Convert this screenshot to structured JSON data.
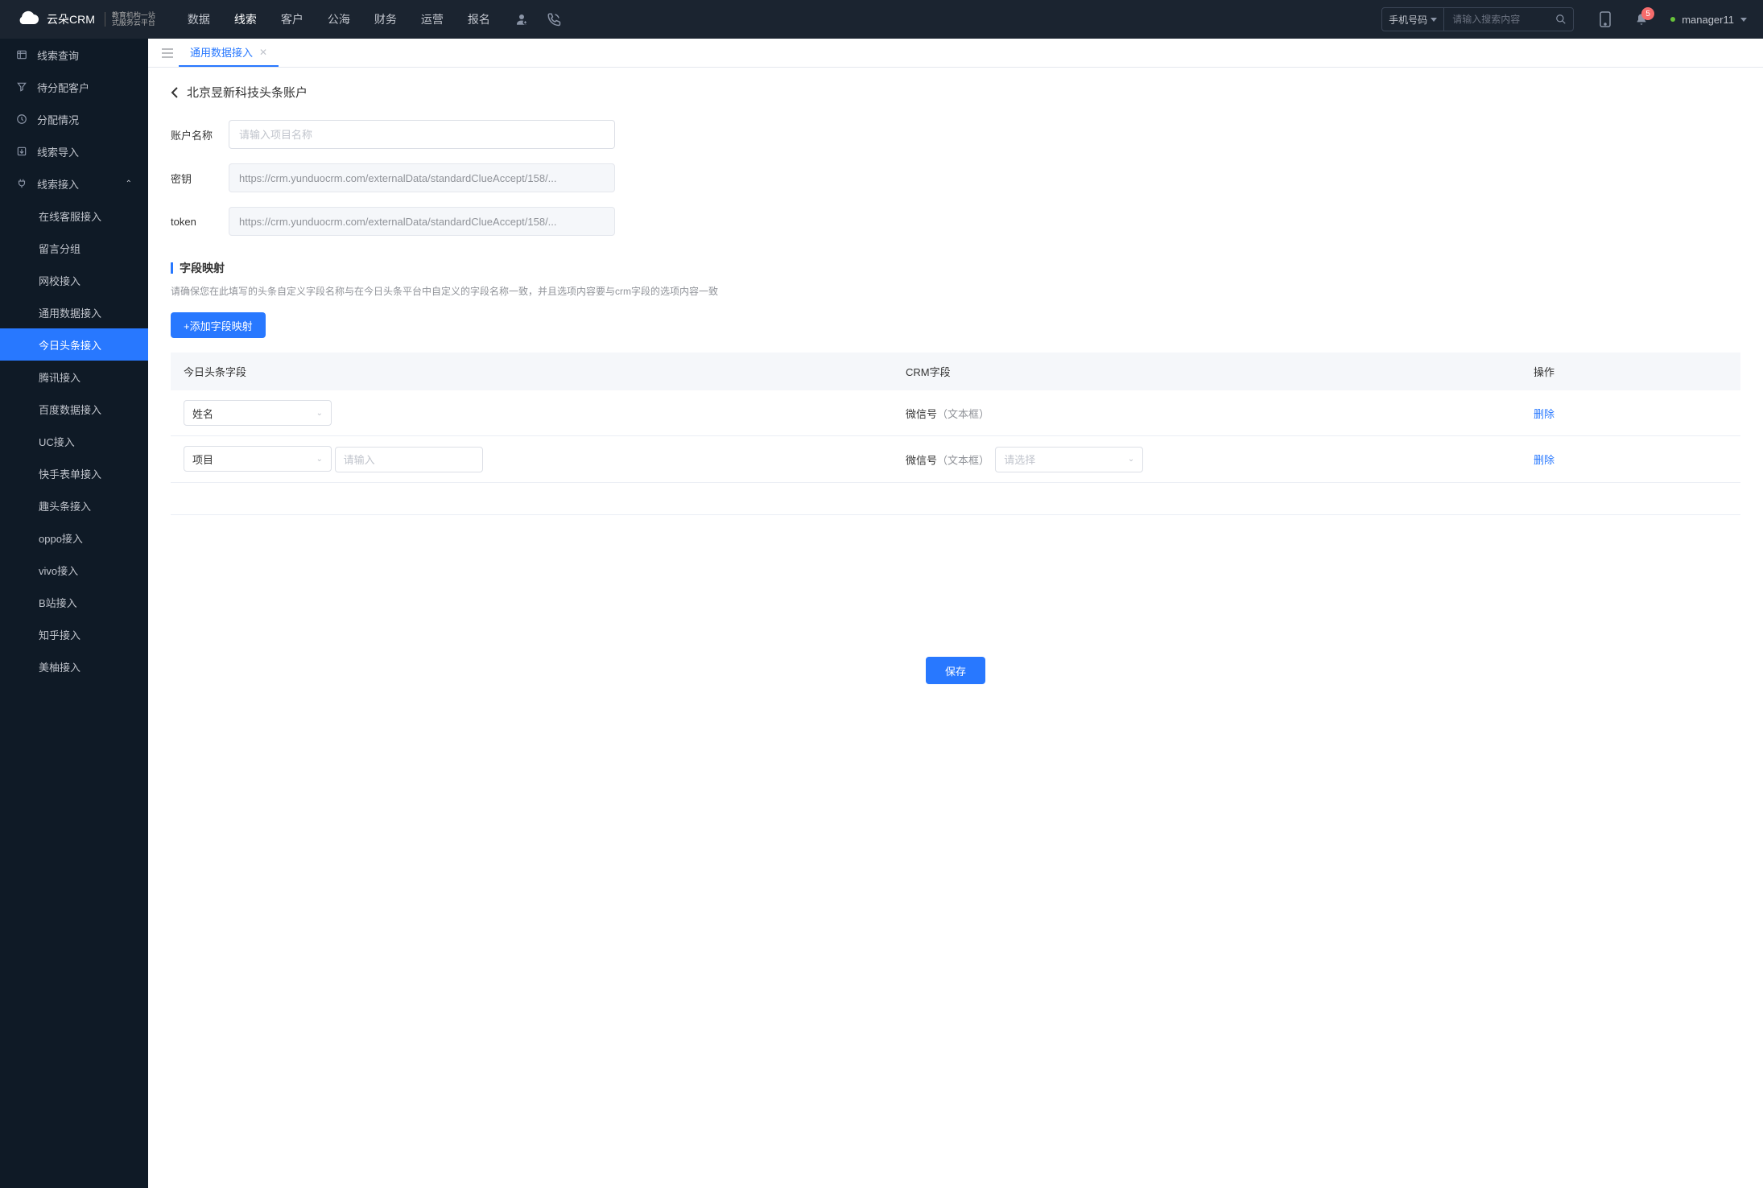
{
  "header": {
    "logo_text": "云朵CRM",
    "logo_sub1": "教育机构一站",
    "logo_sub2": "式服务云平台",
    "nav": [
      "数据",
      "线索",
      "客户",
      "公海",
      "财务",
      "运营",
      "报名"
    ],
    "nav_active_index": 1,
    "search_type": "手机号码",
    "search_placeholder": "请输入搜索内容",
    "badge_count": "5",
    "username": "manager11"
  },
  "sidebar": {
    "items": [
      {
        "label": "线索查询",
        "icon": "list"
      },
      {
        "label": "待分配客户",
        "icon": "filter"
      },
      {
        "label": "分配情况",
        "icon": "clock"
      },
      {
        "label": "线索导入",
        "icon": "export"
      },
      {
        "label": "线索接入",
        "icon": "plug",
        "expanded": true
      }
    ],
    "subs": [
      "在线客服接入",
      "留言分组",
      "网校接入",
      "通用数据接入",
      "今日头条接入",
      "腾讯接入",
      "百度数据接入",
      "UC接入",
      "快手表单接入",
      "趣头条接入",
      "oppo接入",
      "vivo接入",
      "B站接入",
      "知乎接入",
      "美柚接入"
    ],
    "active_sub_index": 4
  },
  "tab": {
    "label": "通用数据接入"
  },
  "page": {
    "title": "北京昱新科技头条账户",
    "form": {
      "account_label": "账户名称",
      "account_placeholder": "请输入项目名称",
      "secret_label": "密钥",
      "secret_value": "https://crm.yunduocrm.com/externalData/standardClueAccept/158/...",
      "token_label": "token",
      "token_value": "https://crm.yunduocrm.com/externalData/standardClueAccept/158/..."
    },
    "mapping": {
      "title": "字段映射",
      "desc": "请确保您在此填写的头条自定义字段名称与在今日头条平台中自定义的字段名称一致，并且选项内容要与crm字段的选项内容一致",
      "add_btn": "+添加字段映射",
      "columns": {
        "c1": "今日头条字段",
        "c2": "CRM字段",
        "c3": "操作"
      },
      "rows": [
        {
          "field_select": "姓名",
          "crm_label": "微信号",
          "crm_type": "（文本框）",
          "action": "删除",
          "has_extra": false
        },
        {
          "field_select": "项目",
          "extra_placeholder": "请输入",
          "crm_label": "微信号",
          "crm_type": "（文本框）",
          "crm_select_placeholder": "请选择",
          "action": "删除",
          "has_extra": true
        }
      ]
    },
    "save_btn": "保存"
  }
}
